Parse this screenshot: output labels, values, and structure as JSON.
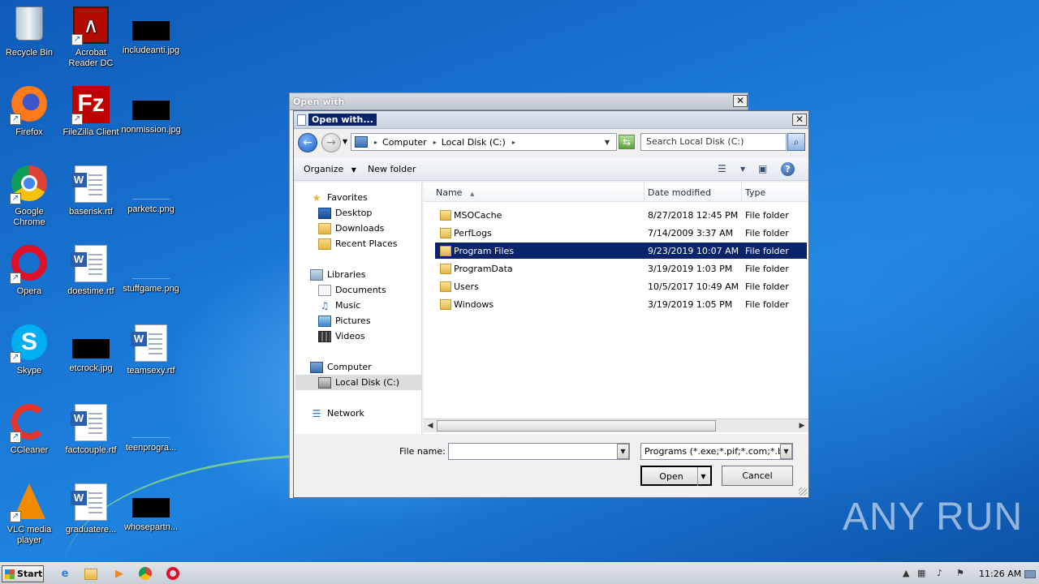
{
  "desktop": {
    "icons": [
      {
        "label": "Recycle Bin"
      },
      {
        "label": "Acrobat Reader DC"
      },
      {
        "label": "includeanti.jpg"
      },
      {
        "label": "Firefox"
      },
      {
        "label": "FileZilla Client"
      },
      {
        "label": "nonmission.jpg"
      },
      {
        "label": "Google Chrome"
      },
      {
        "label": "baserisk.rtf"
      },
      {
        "label": "parketc.png"
      },
      {
        "label": "Opera"
      },
      {
        "label": "doestime.rtf"
      },
      {
        "label": "stuffgame.png"
      },
      {
        "label": "Skype"
      },
      {
        "label": "etcrock.jpg"
      },
      {
        "label": "teamsexy.rtf"
      },
      {
        "label": "CCleaner"
      },
      {
        "label": "factcouple.rtf"
      },
      {
        "label": "teenprogra..."
      },
      {
        "label": "VLC media player"
      },
      {
        "label": "graduatere..."
      },
      {
        "label": "whosepartn..."
      }
    ]
  },
  "back_window": {
    "title": "Open with"
  },
  "dialog": {
    "title": "Open with...",
    "address": {
      "crumbs": [
        "Computer",
        "Local Disk (C:)"
      ]
    },
    "search_placeholder": "Search Local Disk (C:)",
    "toolbar": {
      "organize": "Organize",
      "new_folder": "New folder",
      "help": "?"
    },
    "nav": {
      "favorites": "Favorites",
      "desktop": "Desktop",
      "downloads": "Downloads",
      "recent": "Recent Places",
      "libraries": "Libraries",
      "documents": "Documents",
      "music": "Music",
      "pictures": "Pictures",
      "videos": "Videos",
      "computer": "Computer",
      "local_disk": "Local Disk (C:)",
      "network": "Network"
    },
    "columns": {
      "name": "Name",
      "date": "Date modified",
      "type": "Type"
    },
    "files": [
      {
        "name": "MSOCache",
        "date": "8/27/2018 12:45 PM",
        "type": "File folder"
      },
      {
        "name": "PerfLogs",
        "date": "7/14/2009 3:37 AM",
        "type": "File folder"
      },
      {
        "name": "Program Files",
        "date": "9/23/2019 10:07 AM",
        "type": "File folder"
      },
      {
        "name": "ProgramData",
        "date": "3/19/2019 1:03 PM",
        "type": "File folder"
      },
      {
        "name": "Users",
        "date": "10/5/2017 10:49 AM",
        "type": "File folder"
      },
      {
        "name": "Windows",
        "date": "3/19/2019 1:05 PM",
        "type": "File folder"
      }
    ],
    "selected_file": "Program Files",
    "file_name_label": "File name:",
    "file_name_value": "",
    "filter": "Programs (*.exe;*.pif;*.com;*.bat;*.cmd)",
    "open_button": "Open",
    "cancel_button": "Cancel"
  },
  "taskbar": {
    "start": "Start",
    "clock": "11:26 AM"
  },
  "watermark": "ANY RUN"
}
